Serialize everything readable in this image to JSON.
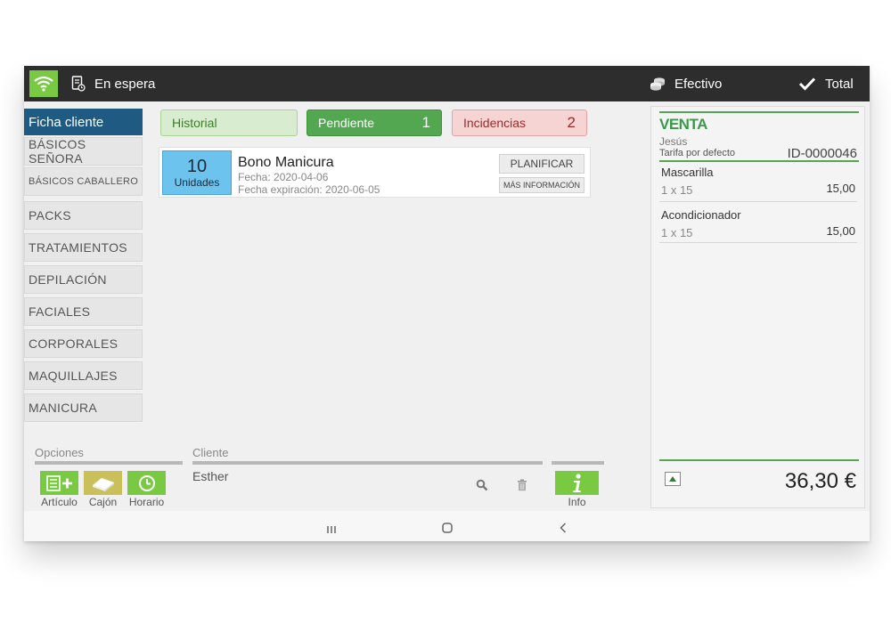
{
  "topbar": {
    "en_espera": "En espera",
    "efectivo": "Efectivo",
    "total": "Total"
  },
  "sidebar": {
    "items": [
      {
        "label": "Ficha cliente",
        "active": true
      },
      {
        "label": "BÁSICOS SEÑORA"
      },
      {
        "label": "BÁSICOS CABALLERO"
      },
      {
        "label": "PACKS"
      },
      {
        "label": "TRATAMIENTOS"
      },
      {
        "label": "DEPILACIÓN"
      },
      {
        "label": "FACIALES"
      },
      {
        "label": "CORPORALES"
      },
      {
        "label": "MAQUILLAJES"
      },
      {
        "label": "MANICURA"
      }
    ]
  },
  "tabs": {
    "historial": {
      "label": "Historial"
    },
    "pendiente": {
      "label": "Pendiente",
      "count": "1"
    },
    "incidencias": {
      "label": "Incidencias",
      "count": "2"
    }
  },
  "bono": {
    "units_value": "10",
    "units_label": "Unidades",
    "title": "Bono Manicura",
    "fecha": "Fecha: 2020-04-06",
    "fecha_expiracion": "Fecha expiración: 2020-06-05",
    "planificar": "PLANIFICAR",
    "mas_info": "MÁS INFORMACIÓN"
  },
  "opciones": {
    "label": "Opciones",
    "articulo": "Artículo",
    "cajon": "Cajón",
    "horario": "Horario"
  },
  "cliente": {
    "label": "Cliente",
    "value": "Esther"
  },
  "info": {
    "label": "Info"
  },
  "venta": {
    "title": "VENTA",
    "customer": "Jesús",
    "tarifa": "Tarifa por defecto",
    "id": "ID-0000046",
    "lines": [
      {
        "name": "Mascarilla",
        "qty": "1 x 15",
        "amount": "15,00"
      },
      {
        "name": "Acondicionador",
        "qty": "1 x 15",
        "amount": "15,00"
      }
    ],
    "total": "36,30 €"
  },
  "colors": {
    "accent_green": "#53a750",
    "wifi_green": "#7ac943",
    "active_blue": "#1e5a82",
    "units_blue": "#6cc3ee",
    "topbar": "#2d2d2d"
  }
}
